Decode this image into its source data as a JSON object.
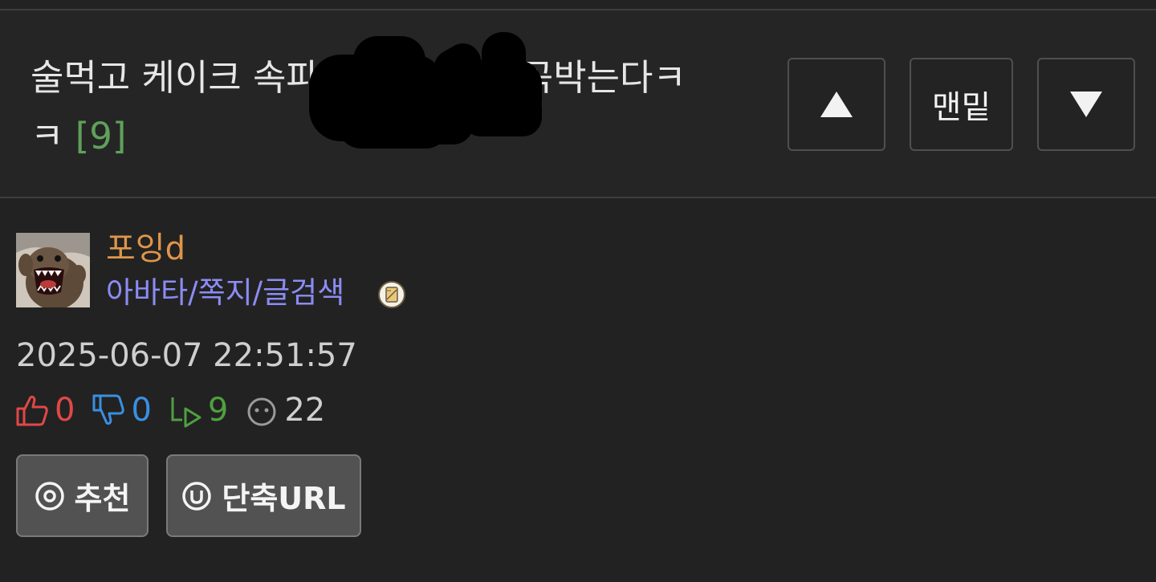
{
  "post": {
    "title_line1": "술먹고 케이크 속파",
    "title_line1_tail": "곡박는다ㅋ",
    "title_line2": "ㅋ",
    "comment_count": "[9]"
  },
  "nav": {
    "up_icon": "triangle-up-icon",
    "bottom_label": "맨밑",
    "down_icon": "triangle-down-icon"
  },
  "author": {
    "name": "포잉d",
    "links": "아바타/쪽지/글검색",
    "badge_icon": "scroll-badge-icon"
  },
  "meta": {
    "date": "2025-06-07 22:51:57"
  },
  "stats": {
    "likes": "0",
    "dislikes": "0",
    "replies": "9",
    "views": "22"
  },
  "actions": {
    "recommend_label": "추천",
    "short_url_label": "단축URL"
  },
  "colors": {
    "background": "#222222",
    "author_name": "#e0954a",
    "author_links": "#8c8cf5",
    "comment_count": "#5fa15a",
    "like": "#e04848",
    "dislike": "#3a8fe0",
    "reply": "#4fa040"
  }
}
